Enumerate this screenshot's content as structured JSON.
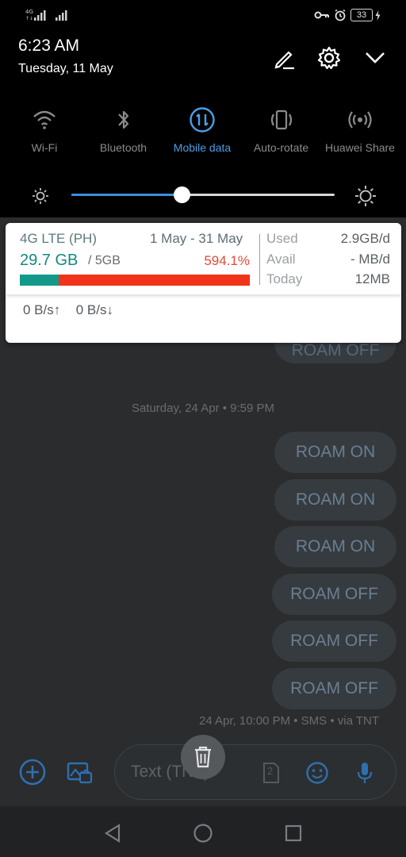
{
  "status_bar": {
    "battery_level": "33"
  },
  "shade": {
    "time": "6:23 AM",
    "date": "Tuesday, 11 May",
    "tiles": [
      {
        "label": "Wi-Fi",
        "icon": "wifi-icon",
        "active": false
      },
      {
        "label": "Bluetooth",
        "icon": "bluetooth-icon",
        "active": false
      },
      {
        "label": "Mobile data",
        "icon": "mobile-data-icon",
        "active": true
      },
      {
        "label": "Auto-rotate",
        "icon": "auto-rotate-icon",
        "active": false
      },
      {
        "label": "Huawei Share",
        "icon": "huawei-share-icon",
        "active": false
      }
    ],
    "brightness_level": 0.42,
    "accent_color": "#4b9fe6"
  },
  "data_card": {
    "network": "4G LTE  (PH)",
    "period": "1 May - 31 May",
    "used": "29.7 GB",
    "limit": "/ 5GB",
    "percent": "594.1%",
    "bar_fraction": 0.17,
    "stats": [
      {
        "label": "Used",
        "value": "2.9GB/d"
      },
      {
        "label": "Avail",
        "value": "- MB/d"
      },
      {
        "label": "Today",
        "value": "12MB"
      }
    ],
    "speed_up": "0 B/s↑",
    "speed_down": "0 B/s↓"
  },
  "conversation": {
    "partial_bubble": "ROAM OFF",
    "day_label": "Saturday, 24 Apr • 9:59 PM",
    "bubbles": [
      "ROAM ON",
      "ROAM ON",
      "ROAM ON",
      "ROAM OFF",
      "ROAM OFF",
      "ROAM OFF"
    ],
    "meta": "24 Apr, 10:00 PM • SMS • via TNT"
  },
  "compose": {
    "placeholder": "Text (TNT)",
    "sim_label": "2"
  }
}
